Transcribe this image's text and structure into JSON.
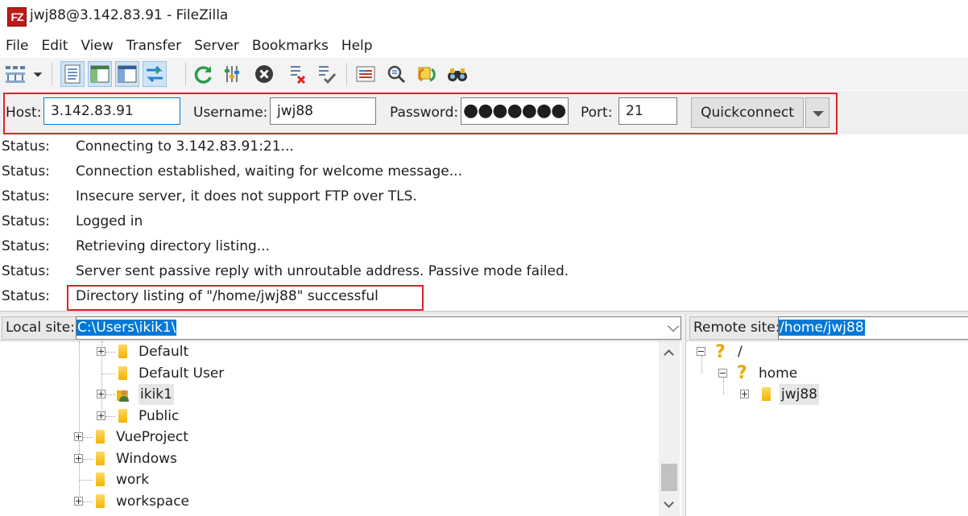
{
  "window": {
    "title": "jwj88@3.142.83.91 - FileZilla",
    "app_icon_text": "FZ"
  },
  "menu": [
    "File",
    "Edit",
    "View",
    "Transfer",
    "Server",
    "Bookmarks",
    "Help"
  ],
  "toolbar": {
    "icons": [
      "site-manager-icon",
      "site-manager-dropdown-icon",
      "toggle-message-log-icon",
      "toggle-local-tree-icon",
      "toggle-remote-tree-icon",
      "toggle-transfer-queue-icon",
      "refresh-icon",
      "process-queue-icon",
      "cancel-icon",
      "disconnect-icon",
      "reconnect-icon",
      "directory-listing-filters-icon",
      "toggle-directory-comparison-icon",
      "synchronized-browsing-icon",
      "search-remote-files-icon"
    ]
  },
  "quickconnect": {
    "host_label": "Host:",
    "host_value": "3.142.83.91",
    "username_label": "Username:",
    "username_value": "jwj88",
    "password_label": "Password:",
    "password_mask": "●●●●●●●",
    "port_label": "Port:",
    "port_value": "21",
    "button_label": "Quickconnect"
  },
  "log": [
    {
      "key": "Status:",
      "message": "Connecting to 3.142.83.91:21..."
    },
    {
      "key": "Status:",
      "message": "Connection established, waiting for welcome message..."
    },
    {
      "key": "Status:",
      "message": "Insecure server, it does not support FTP over TLS."
    },
    {
      "key": "Status:",
      "message": "Logged in"
    },
    {
      "key": "Status:",
      "message": "Retrieving directory listing..."
    },
    {
      "key": "Status:",
      "message": "Server sent passive reply with unroutable address. Passive mode failed."
    },
    {
      "key": "Status:",
      "message": "Directory listing of \"/home/jwj88\" successful"
    }
  ],
  "local": {
    "label": "Local site:",
    "path": "C:\\Users\\ikik1\\",
    "tree": [
      {
        "name": "Default"
      },
      {
        "name": "Default User"
      },
      {
        "name": "ikik1"
      },
      {
        "name": "Public"
      },
      {
        "name": "VueProject"
      },
      {
        "name": "Windows"
      },
      {
        "name": "work"
      },
      {
        "name": "workspace"
      }
    ]
  },
  "remote": {
    "label": "Remote site:",
    "path": "/home/jwj88",
    "tree": [
      {
        "name": "/"
      },
      {
        "name": "home"
      },
      {
        "name": "jwj88"
      }
    ]
  }
}
